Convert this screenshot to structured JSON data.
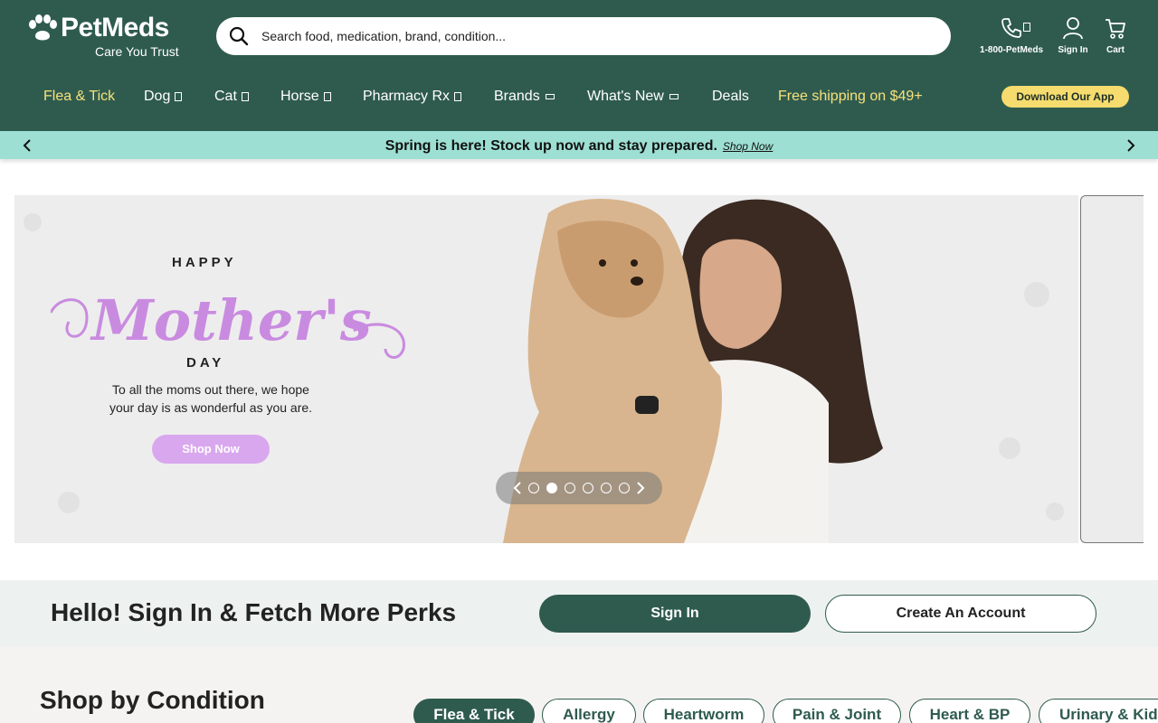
{
  "brand": {
    "name": "PetMeds",
    "tagline": "Care You Trust"
  },
  "search": {
    "placeholder": "Search food, medication, brand, condition..."
  },
  "utility": {
    "phone": "1-800-PetMeds",
    "sign_in": "Sign In",
    "cart": "Cart"
  },
  "nav": {
    "items": [
      "Flea & Tick",
      "Dog",
      "Cat",
      "Horse",
      "Pharmacy Rx",
      "Brands",
      "What's New",
      "Deals",
      "Free shipping on $49+"
    ],
    "app_button": "Download Our App"
  },
  "promo": {
    "text": "Spring is here! Stock up now and stay prepared.",
    "link": "Shop Now"
  },
  "hero": {
    "happy": "HAPPY",
    "mothers": "Mother's",
    "day": "DAY",
    "copy_line1": "To all the moms out there, we hope",
    "copy_line2": "your day is as wonderful as you are.",
    "cta": "Shop Now",
    "slide_count": 6,
    "active_slide": 2
  },
  "perks": {
    "title": "Hello! Sign In & Fetch More Perks",
    "sign_in": "Sign In",
    "create": "Create An Account"
  },
  "conditions": {
    "title": "Shop by Condition",
    "pills": [
      "Flea & Tick",
      "Allergy",
      "Heartworm",
      "Pain & Joint",
      "Heart & BP",
      "Urinary & Kidney"
    ]
  },
  "colors": {
    "header": "#2f5b4f",
    "promo": "#9ddfd3",
    "accent_yellow": "#f6dc6e",
    "hero_pink": "#d9a7ee"
  }
}
